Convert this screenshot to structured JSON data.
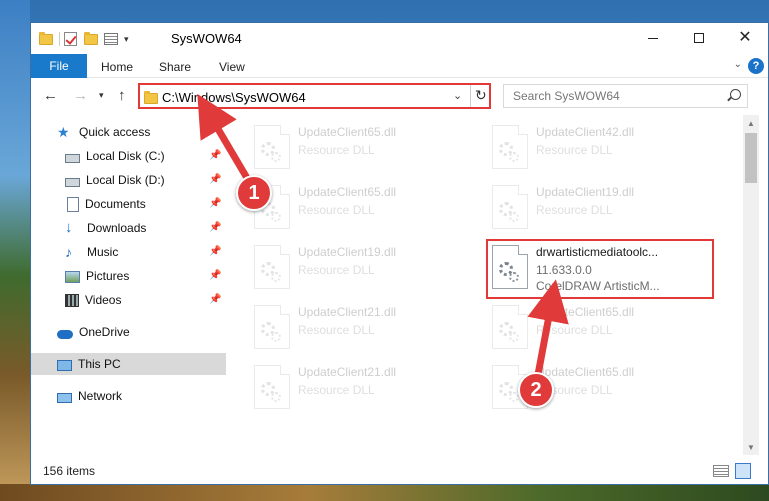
{
  "window": {
    "title": "SysWOW64"
  },
  "ribbon": {
    "file": "File",
    "home": "Home",
    "share": "Share",
    "view": "View",
    "help": "?"
  },
  "navigation": {
    "address": "C:\\Windows\\SysWOW64",
    "search_placeholder": "Search SysWOW64"
  },
  "sidebar": {
    "quick_access": "Quick access",
    "local_disk_c": "Local Disk (C:)",
    "local_disk_d": "Local Disk (D:)",
    "documents": "Documents",
    "downloads": "Downloads",
    "music": "Music",
    "pictures": "Pictures",
    "videos": "Videos",
    "onedrive": "OneDrive",
    "this_pc": "This PC",
    "network": "Network"
  },
  "files": [
    {
      "name": "UpdateClient65.dll",
      "sub1": "Resource DLL"
    },
    {
      "name": "UpdateClient42.dll",
      "sub1": "Resource DLL"
    },
    {
      "name": "UpdateClient65.dll",
      "sub1": "Resource DLL"
    },
    {
      "name": "UpdateClient19.dll",
      "sub1": "Resource DLL"
    },
    {
      "name": "UpdateClient19.dll",
      "sub1": "Resource DLL"
    },
    {
      "name": "drwartisticmediatoolc...",
      "sub1": "11.633.0.0",
      "sub2": "CorelDRAW ArtisticM..."
    },
    {
      "name": "UpdateClient21.dll",
      "sub1": "Resource DLL"
    },
    {
      "name": "UpdateClient65.dll",
      "sub1": "Resource DLL"
    },
    {
      "name": "UpdateClient21.dll",
      "sub1": "Resource DLL"
    },
    {
      "name": "UpdateClient65.dll",
      "sub1": "Resource DLL"
    }
  ],
  "status": {
    "item_count": "156 items"
  },
  "annotations": {
    "step1": "1",
    "step2": "2",
    "color": "#e03a3a"
  }
}
